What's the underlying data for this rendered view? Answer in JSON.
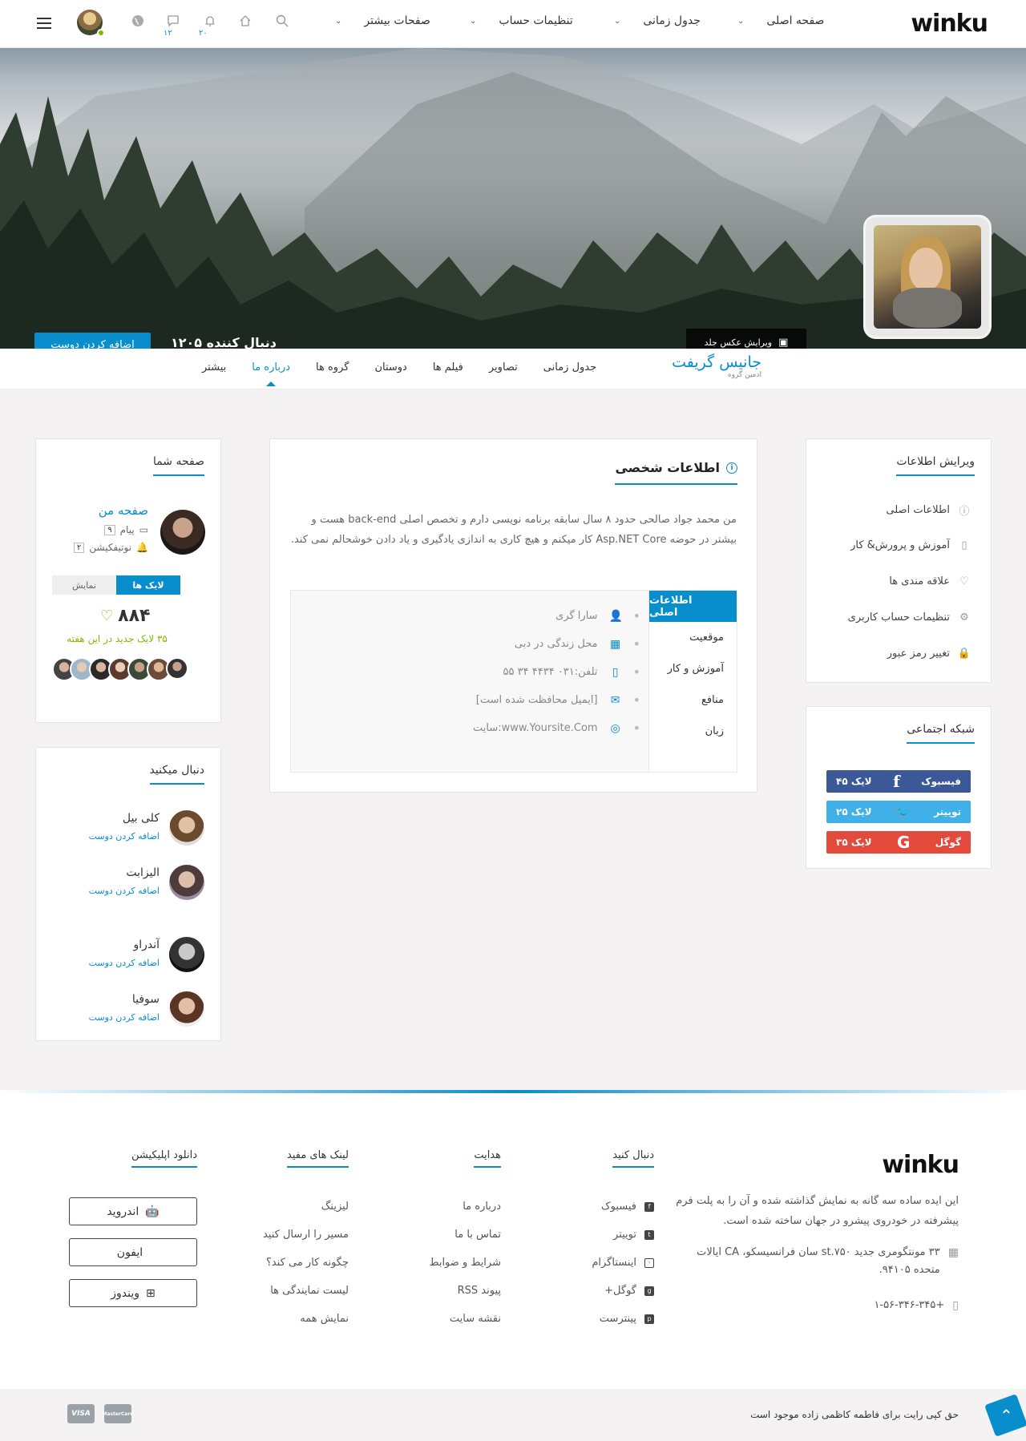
{
  "topbar": {
    "logo": "winku",
    "menu": [
      {
        "label": "صفحه اصلی"
      },
      {
        "label": "جدول زمانی"
      },
      {
        "label": "تنظیمات حساب"
      },
      {
        "label": "صفحات بیشتر"
      }
    ],
    "messages_count": "۱۲",
    "notifications_count": "۲۰"
  },
  "cover": {
    "edit_cover_label": "ویرایش عکس جلد",
    "followers_label": "۱۲۰۵ دنبال کننده",
    "add_friend_label": "اضافه کردن دوست"
  },
  "profile": {
    "name": "جانیس گریفت",
    "role": "ادمین گروه",
    "tabs": [
      "جدول زمانی",
      "تصاویر",
      "فیلم ها",
      "دوستان",
      "گروه ها",
      "درباره ما",
      "بیشتر"
    ],
    "active_tab": "درباره ما"
  },
  "edit_info": {
    "title": "ویرایش اطلاعات",
    "items": [
      {
        "label": "اطلاعات اصلی",
        "icon": "info-icon"
      },
      {
        "label": "آموزش و پرورش& کار",
        "icon": "mouse-icon"
      },
      {
        "label": "علاقه مندی ها",
        "icon": "heart-icon"
      },
      {
        "label": "تنظیمات حساب کاربری",
        "icon": "gear-icon"
      },
      {
        "label": "تغییر رمز عبور",
        "icon": "lock-icon"
      }
    ]
  },
  "social_network": {
    "title": "شبکه اجتماعی",
    "items": [
      {
        "name": "فیسبوک",
        "likes": "۴۵ لایک",
        "color": "#3b5998",
        "icon": "facebook-icon",
        "glyph": "f"
      },
      {
        "name": "توییتر",
        "likes": "۲۵ لایک",
        "color": "#3fb0e8",
        "icon": "twitter-icon",
        "glyph": "🐦"
      },
      {
        "name": "گوگل",
        "likes": "۳۵ لایک",
        "color": "#e44a3c",
        "icon": "google-icon",
        "glyph": "G"
      }
    ]
  },
  "personal_info": {
    "title": "اطلاعات شخصی",
    "bio": "من محمد جواد صالحی حدود ۸ سال سابقه برنامه نویسی دارم و تخصص اصلی back-end هست و بیشتر در حوضه Asp.NET Core کار میکنم و هیچ کاری به اندازی یادگیری و یاد دادن خوشحالم نمی کند.",
    "tabs": [
      "اطلاعات اصلی",
      "موقعیت",
      "آموزش و کار",
      "منافع",
      "زبان"
    ],
    "rows": [
      {
        "text": "سارا گری",
        "icon": "user-icon",
        "glyph": "👤"
      },
      {
        "text": "محل زندگی در دبی",
        "icon": "map-icon",
        "glyph": "▦"
      },
      {
        "text": "تلفن:۰۳۱ ۴۴۳۴ ۳۴ ۵۵",
        "icon": "phone-icon",
        "glyph": "▯"
      },
      {
        "text": "[ایمیل محافظت شده است]",
        "icon": "email-icon",
        "glyph": "✉"
      },
      {
        "text": "سایت:www.Yoursite.Com",
        "icon": "globe-icon",
        "glyph": "◎"
      }
    ]
  },
  "your_page": {
    "title": "صفحه شما",
    "my_page_label": "صفحه من",
    "messages": "پیام",
    "messages_count": "۹",
    "notifications": "نوتیفکیشن",
    "notifications_count": "۲",
    "toggle_likes": "لایک ها",
    "toggle_views": "نمایش",
    "likes_total": "۸۸۴",
    "new_likes": "۳۵ لایک جدید در این هفته"
  },
  "following": {
    "title": "دنبال میکنید",
    "items": [
      {
        "name": "کلی بیل",
        "action": "اضافه کردن دوست"
      },
      {
        "name": "الیزابت",
        "action": "اضافه کردن دوست"
      },
      {
        "name": "آندراو",
        "action": "اضافه کردن دوست"
      },
      {
        "name": "سوفیا",
        "action": "اضافه کردن دوست"
      }
    ]
  },
  "footer": {
    "logo": "winku",
    "about": "این ایده ساده سه گانه به نمایش گذاشته شده و آن را به پلت فرم پیشرفته در خودروی پیشرو در جهان ساخته شده است.",
    "address": "۳۳ مونتگومری جدید st.۷۵۰ سان فرانسیسکو، CA ایالات متحده ۹۴۱۰۵.",
    "phone": "+۱-۵۶-۳۴۶-۳۴۵",
    "follow_title": "دنبال کنید",
    "follow_links": [
      "فیسبوک",
      "توییتر",
      "اینستاگرام",
      "گوگل+",
      "پینترست"
    ],
    "nav_title": "هدایت",
    "nav_links": [
      "درباره ما",
      "تماس با ما",
      "شرایط و ضوابط",
      "پیوند RSS",
      "نقشه سایت"
    ],
    "useful_title": "لینک های مفید",
    "useful_links": [
      "لیزینگ",
      "مسیر را ارسال کنید",
      "چگونه کار می کند؟",
      "لیست نمایندگی ها",
      "نمایش همه"
    ],
    "download_title": "دانلود اپلیکیشن",
    "apps": [
      "اندروید",
      "ایفون",
      "ویندوز"
    ],
    "copyright": "حق کپی رایت برای فاطمه کاظمی زاده موجود است",
    "cards": [
      "VISA",
      "MasterCard"
    ]
  }
}
